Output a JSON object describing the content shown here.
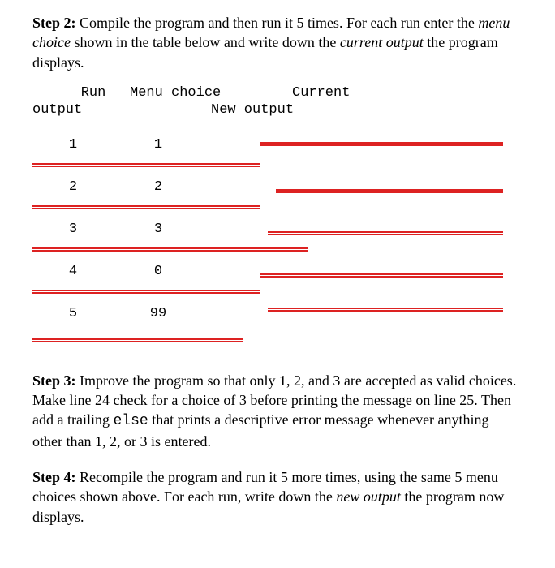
{
  "step2": {
    "label": "Step 2:",
    "text_part1": "Compile the program and then run it 5 times.  For each run enter the ",
    "italic_part1": "menu choice",
    "text_part2": " shown in the table below and write down the ",
    "italic_part2": "current output",
    "text_part3": " the program displays."
  },
  "table": {
    "header_run": "Run",
    "header_menu": "Menu choice",
    "header_current": "Current",
    "header_output": "output",
    "header_new_output": "New output",
    "rows": [
      {
        "run": "1",
        "choice": "1"
      },
      {
        "run": "2",
        "choice": "2"
      },
      {
        "run": "3",
        "choice": "3"
      },
      {
        "run": "4",
        "choice": "0"
      },
      {
        "run": "5",
        "choice": "99"
      }
    ]
  },
  "chart_data": {
    "type": "table",
    "columns": [
      "Run",
      "Menu choice",
      "Current output",
      "New output"
    ],
    "rows": [
      [
        "1",
        "1",
        "",
        ""
      ],
      [
        "2",
        "2",
        "",
        ""
      ],
      [
        "3",
        "3",
        "",
        ""
      ],
      [
        "4",
        "0",
        "",
        ""
      ],
      [
        "5",
        "99",
        "",
        ""
      ]
    ]
  },
  "step3": {
    "label": "Step 3:",
    "text_part1": "Improve the program so that only 1, 2, and 3 are accepted as valid choices.  Make line 24 check for a choice of 3 before printing the message on line 25. Then add a trailing ",
    "mono_part1": "else",
    "text_part2": " that prints a descriptive error message whenever anything other than 1, 2, or 3 is entered."
  },
  "step4": {
    "label": "Step 4:",
    "text_part1": "Recompile the program and run it 5 more times, using the same 5 menu choices shown above.  For each run, write down the ",
    "italic_part1": "new output",
    "text_part2": "  the program now displays."
  }
}
